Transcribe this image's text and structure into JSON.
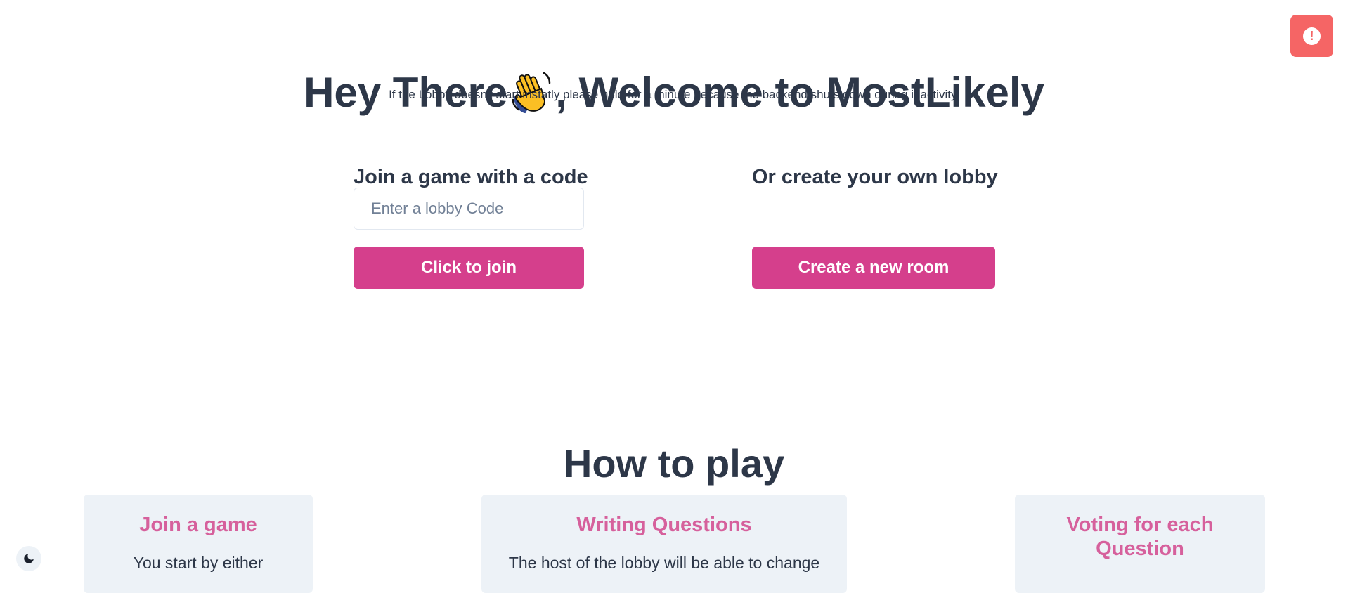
{
  "hero": {
    "title_before": "Hey There",
    "title_after": ", Welcome to MostLikely",
    "wave_icon": "waving-hand-icon",
    "subtitle": "If the Lobby doesn't start instatly please hold for a minute because the backend shuts down during inactivity."
  },
  "alert": {
    "icon": "exclamation-icon",
    "color": "#f56565"
  },
  "join": {
    "title": "Join a game with a code",
    "input_placeholder": "Enter a lobby Code",
    "input_value": "",
    "button_label": "Click to join"
  },
  "create": {
    "title": "Or create your own lobby",
    "button_label": "Create a new room"
  },
  "how_to_play": {
    "title": "How to play",
    "cards": [
      {
        "title": "Join a game",
        "text": "You start by either"
      },
      {
        "title": "Writing Questions",
        "text": "The host of the lobby will be able to change"
      },
      {
        "title": "Voting for each Question",
        "text": ""
      }
    ]
  },
  "theme_toggle": {
    "icon": "moon-icon"
  },
  "colors": {
    "accent": "#d53f8c",
    "card_title": "#d6609c",
    "text": "#2d3748",
    "card_bg": "#edf2f7"
  }
}
